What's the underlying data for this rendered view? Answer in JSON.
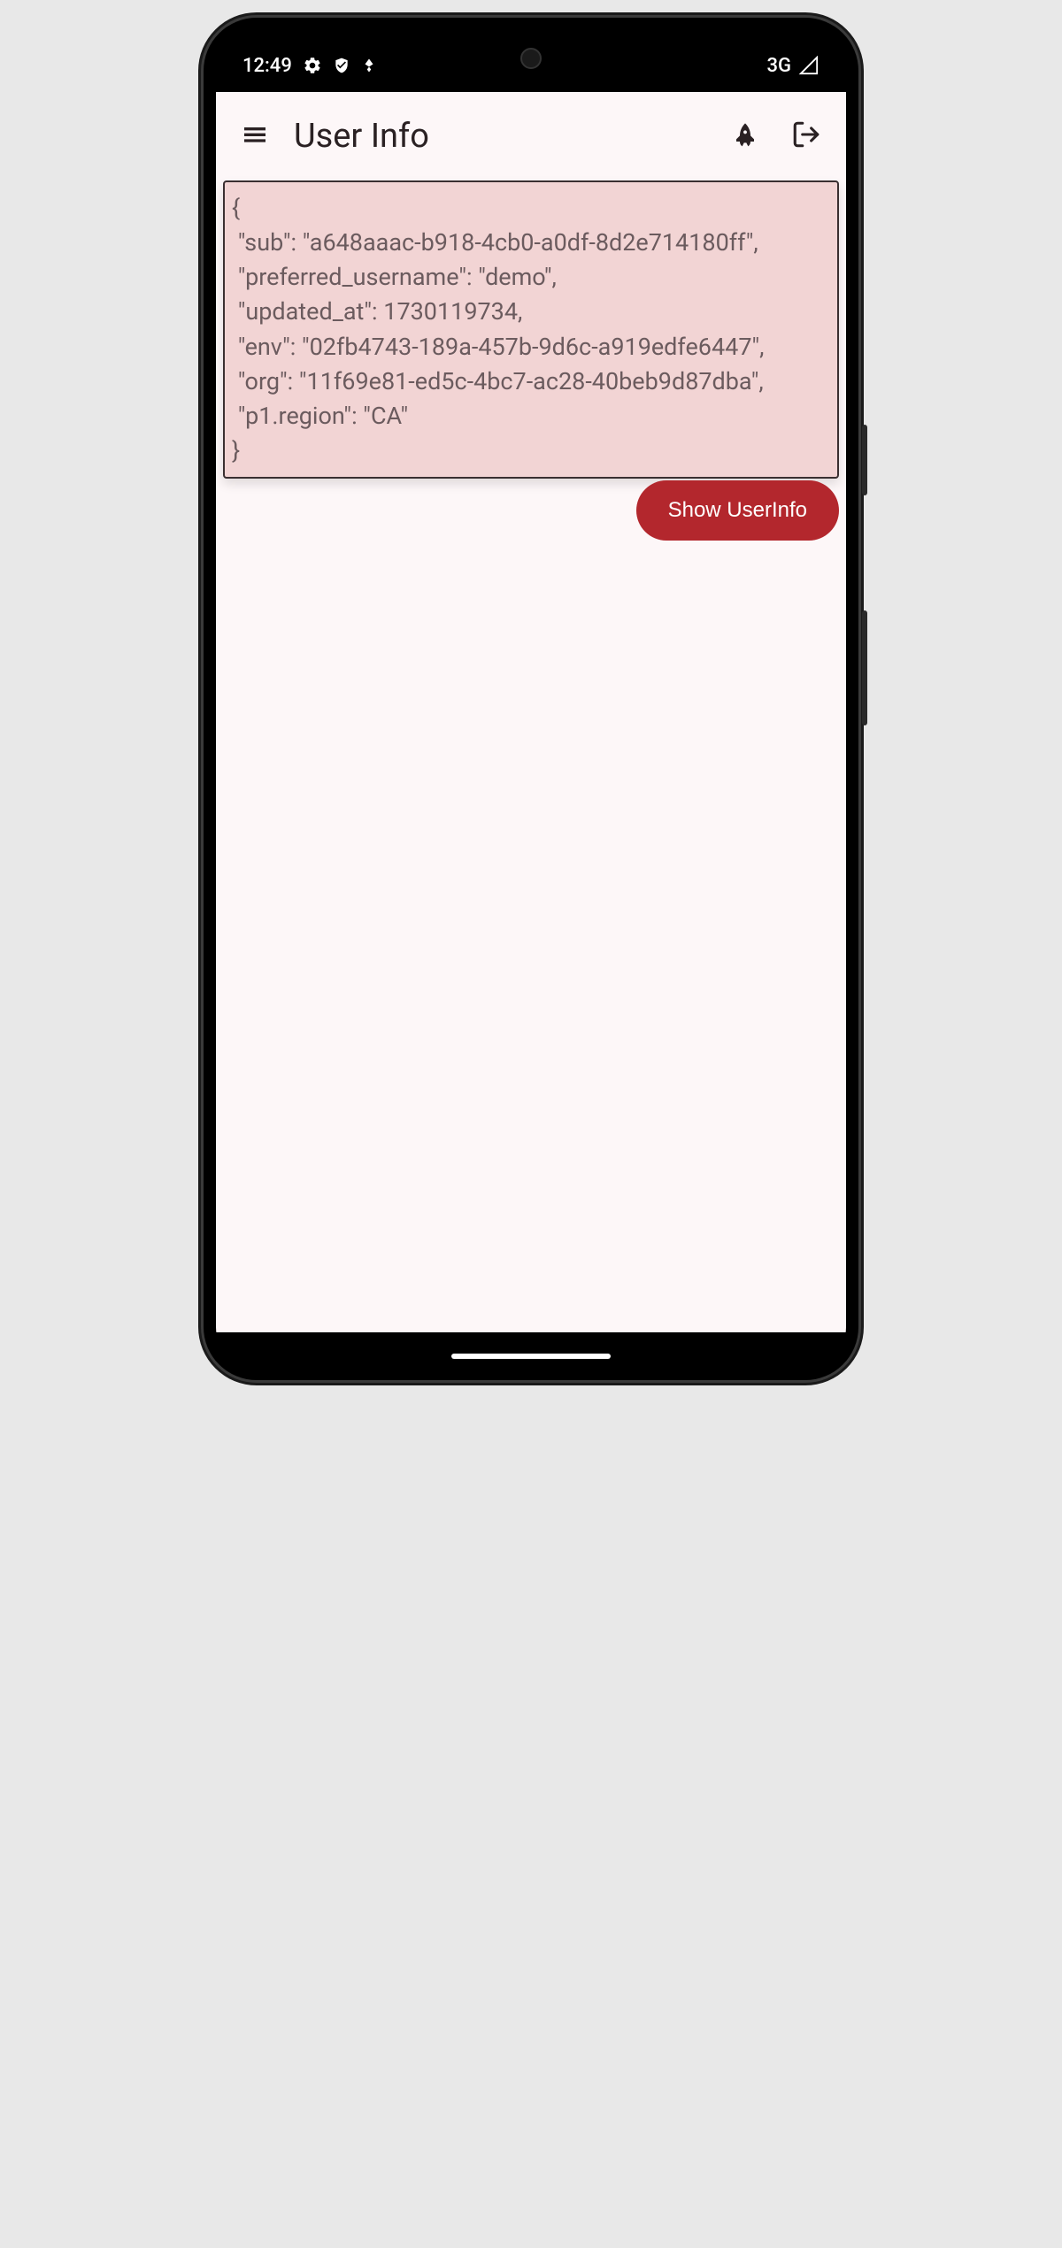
{
  "statusbar": {
    "time": "12:49",
    "network_label": "3G"
  },
  "appbar": {
    "title": "User Info"
  },
  "userinfo_json": "{\n \"sub\": \"a648aaac-b918-4cb0-a0df-8d2e714180ff\",\n \"preferred_username\": \"demo\",\n \"updated_at\": 1730119734,\n \"env\": \"02fb4743-189a-457b-9d6c-a919edfe6447\",\n \"org\": \"11f69e81-ed5c-4bc7-ac28-40beb9d87dba\",\n \"p1.region\": \"CA\"\n}",
  "buttons": {
    "show_userinfo": "Show UserInfo"
  }
}
